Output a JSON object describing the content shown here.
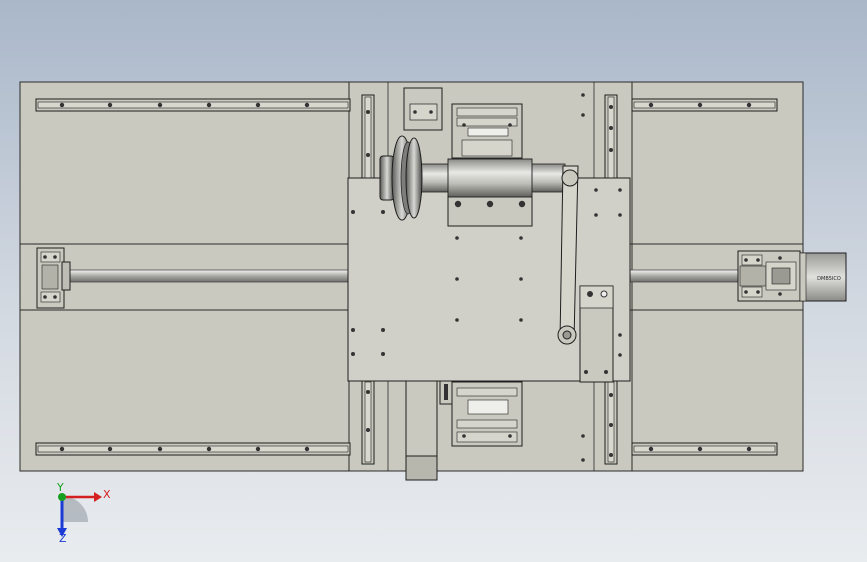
{
  "view": {
    "triad": {
      "x_label": "X",
      "y_label": "Y",
      "z_label": "Z"
    },
    "colors": {
      "background_top": "#a9b7c9",
      "background_bottom": "#e9ecef",
      "part_fill": "#cac9bf",
      "plate_fill": "#d1d0c8",
      "outline": "#2b2b2b",
      "rail": "#1e1e1e",
      "axis_x": "#d42020",
      "axis_y": "#16a020",
      "axis_z": "#1c3ad6"
    },
    "motor_label": "DMB5ICO"
  }
}
